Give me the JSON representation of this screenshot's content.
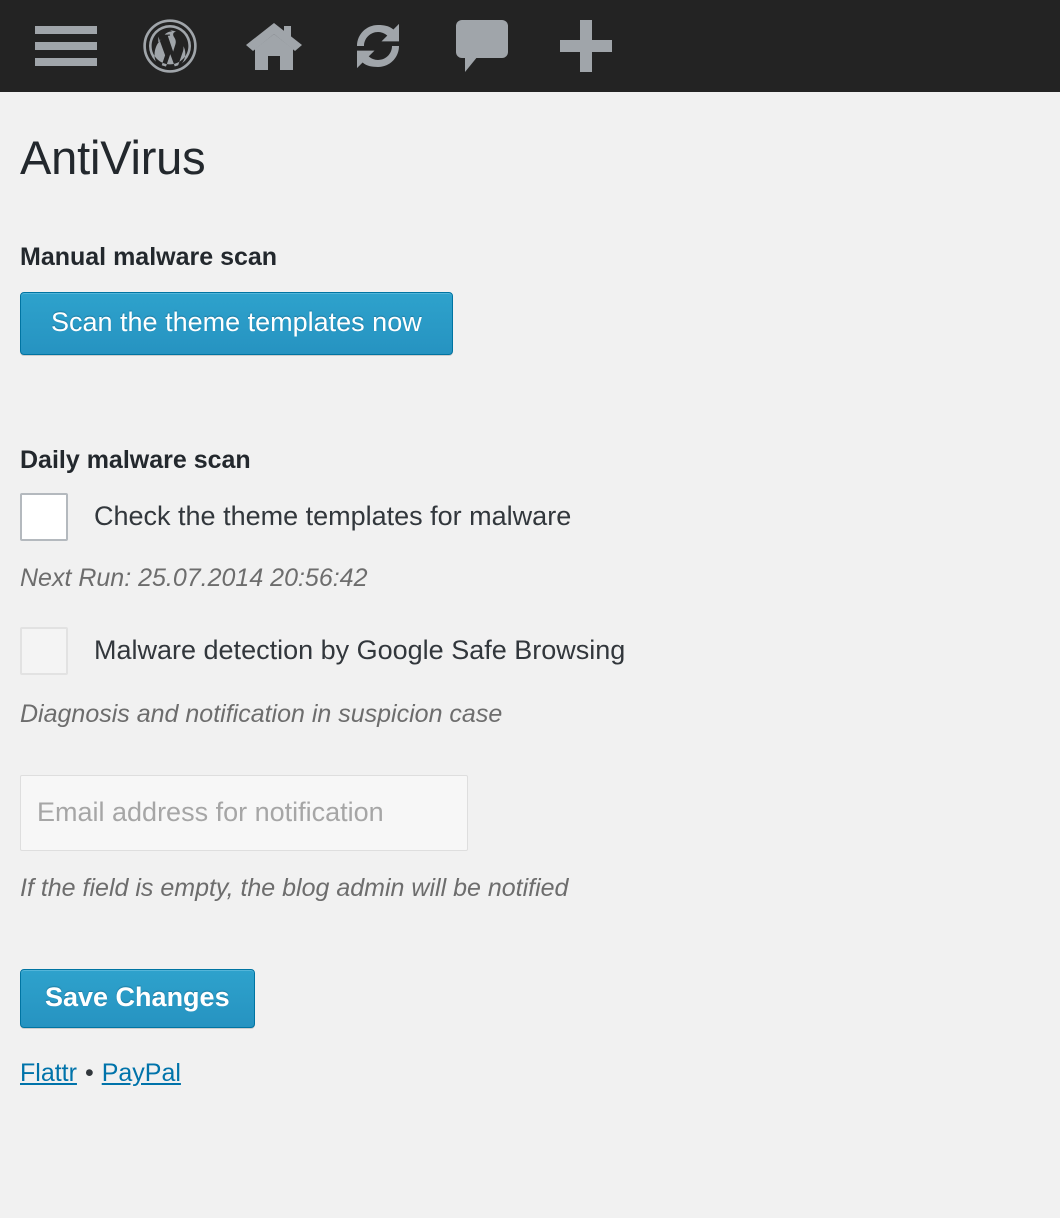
{
  "adminbar": {
    "items": [
      {
        "name": "menu-icon",
        "label": "Menu"
      },
      {
        "name": "wordpress-logo-icon",
        "label": "About WordPress"
      },
      {
        "name": "home-icon",
        "label": "Visit Site"
      },
      {
        "name": "updates-icon",
        "label": "Updates"
      },
      {
        "name": "comments-icon",
        "label": "Comments"
      },
      {
        "name": "new-content-icon",
        "label": "New"
      }
    ]
  },
  "page": {
    "title": "AntiVirus"
  },
  "manual_scan": {
    "heading": "Manual malware scan",
    "scan_button": "Scan the theme templates now"
  },
  "daily_scan": {
    "heading": "Daily malware scan",
    "theme_check_label": "Check the theme templates for malware",
    "next_run": "Next Run: 25.07.2014 20:56:42",
    "safe_browsing_label": "Malware detection by Google Safe Browsing",
    "safe_browsing_note": "Diagnosis and notification in suspicion case"
  },
  "notification": {
    "email_placeholder": "Email address for notification",
    "email_value": "",
    "empty_note": "If the field is empty, the blog admin will be notified"
  },
  "actions": {
    "save_label": "Save Changes"
  },
  "footer": {
    "flattr": "Flattr",
    "separator": "•",
    "paypal": "PayPal"
  },
  "colors": {
    "adminbar_bg": "#232323",
    "page_bg": "#f1f1f1",
    "accent_blue": "#2ea2cc",
    "accent_border": "#0074a2",
    "link_blue": "#0073aa",
    "icon_gray": "#a0a5aa",
    "note_gray": "#6d6d6d"
  }
}
